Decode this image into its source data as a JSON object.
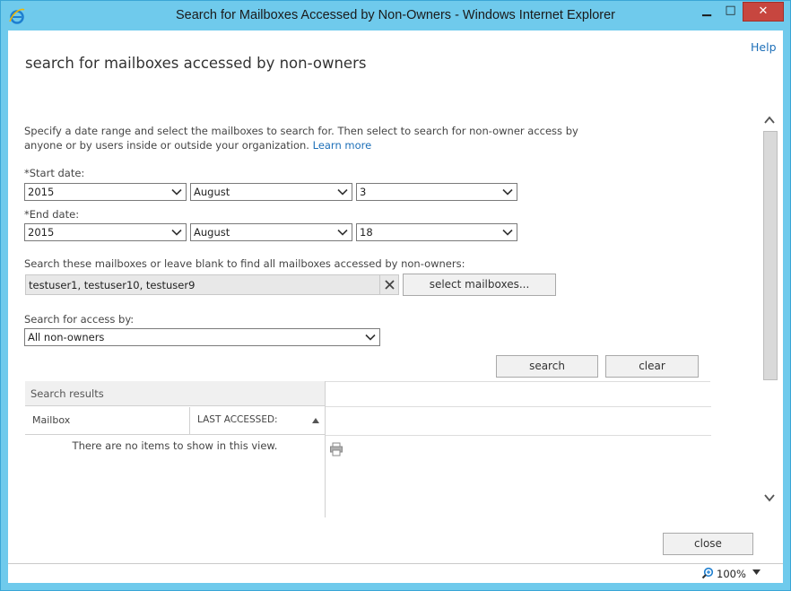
{
  "window": {
    "title": "Search for Mailboxes Accessed by Non-Owners - Windows Internet Explorer",
    "minimize_glyph": "▁",
    "maximize_glyph": "□",
    "close_glyph": "✕",
    "close_color": "#c7463f",
    "frame_color": "#6fcaec"
  },
  "header": {
    "help_label": "Help",
    "page_title": "search for mailboxes accessed by non-owners"
  },
  "description": {
    "text": "Specify a date range and select the mailboxes to search for. Then select to search for non-owner access by anyone or by users inside or outside your organization.",
    "learn_more": "Learn more",
    "link_color": "#1d6fb8"
  },
  "start_date": {
    "label": "*Start date:",
    "year": "2015",
    "month": "August",
    "day": "3"
  },
  "end_date": {
    "label": "*End date:",
    "year": "2015",
    "month": "August",
    "day": "18"
  },
  "mailboxes": {
    "label": "Search these mailboxes or leave blank to find all mailboxes accessed by non-owners:",
    "value": "testuser1, testuser10, testuser9",
    "select_button": "select mailboxes..."
  },
  "access": {
    "label": "Search for access by:",
    "value": "All non-owners"
  },
  "actions": {
    "search": "search",
    "clear": "clear",
    "close": "close"
  },
  "results": {
    "header": "Search results",
    "columns": [
      "Mailbox",
      "LAST ACCESSED:"
    ],
    "empty_message": "There are no items to show in this view."
  },
  "statusbar": {
    "zoom": "100%"
  },
  "icons": {
    "logo": "ie-logo-icon",
    "clear_field": "close-icon",
    "sort": "sort-ascending-icon",
    "print": "print-icon",
    "zoom": "zoom-icon",
    "scroll_up": "chevron-up-icon",
    "scroll_down": "chevron-down-icon",
    "dropdown": "chevron-down-icon"
  }
}
